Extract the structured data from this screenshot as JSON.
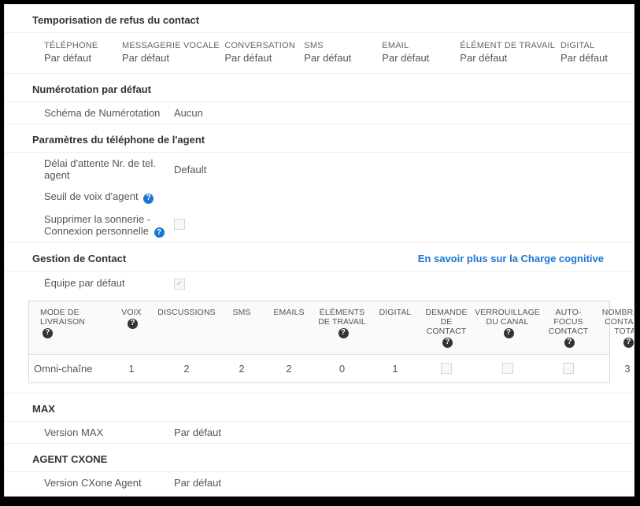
{
  "sections": {
    "refusal_title": "Temporisation de refus du contact",
    "dialing_title": "Numérotation par défaut",
    "phone_title": "Paramètres du téléphone de l'agent",
    "contact_title": "Gestion de Contact",
    "contact_link": "En savoir plus sur la Charge cognitive",
    "max_title": "MAX",
    "cxone_title": "AGENT CXONE"
  },
  "refusal": {
    "phone": {
      "label": "TÉLÉPHONE",
      "value": "Par défaut"
    },
    "voicemail": {
      "label": "MESSAGERIE VOCALE",
      "value": "Par défaut"
    },
    "chat": {
      "label": "CONVERSATION",
      "value": "Par défaut"
    },
    "sms": {
      "label": "SMS",
      "value": "Par défaut"
    },
    "email": {
      "label": "EMAIL",
      "value": "Par défaut"
    },
    "workitem": {
      "label": "ÉLÉMENT DE TRAVAIL",
      "value": "Par défaut"
    },
    "digital": {
      "label": "DIGITAL",
      "value": "Par défaut"
    }
  },
  "dialing": {
    "pattern_label": "Schéma de Numérotation",
    "pattern_value": "Aucun"
  },
  "phone": {
    "timeout_label": "Délai d'attente Nr. de tel. agent",
    "timeout_value": "Default",
    "voice_threshold_label": "Seuil de voix d'agent",
    "suppress_label": "Supprimer la sonnerie - Connexion personnelle"
  },
  "contact": {
    "default_team_label": "Équipe par défaut",
    "headers": {
      "mode": "MODE DE LIVRAISON",
      "voice": "VOIX",
      "chats": "DISCUSSIONS",
      "sms": "SMS",
      "emails": "EMAILS",
      "workitems": "ÉLÉMENTS DE TRAVAIL",
      "digital": "DIGITAL",
      "request": "DEMANDE DE CONTACT",
      "lock": "VERROUILLAGE DU CANAL",
      "autofocus": "AUTO-FOCUS CONTACT",
      "total": "NOMBRE DE CONTACTS TOTAL"
    },
    "row": {
      "mode": "Omni-chaîne",
      "voice": "1",
      "chats": "2",
      "sms": "2",
      "emails": "2",
      "workitems": "0",
      "digital": "1",
      "total": "3"
    }
  },
  "max": {
    "version_label": "Version MAX",
    "version_value": "Par défaut"
  },
  "cxone": {
    "version_label": "Version CXone Agent",
    "version_value": "Par défaut"
  },
  "icons": {
    "help": "?"
  }
}
